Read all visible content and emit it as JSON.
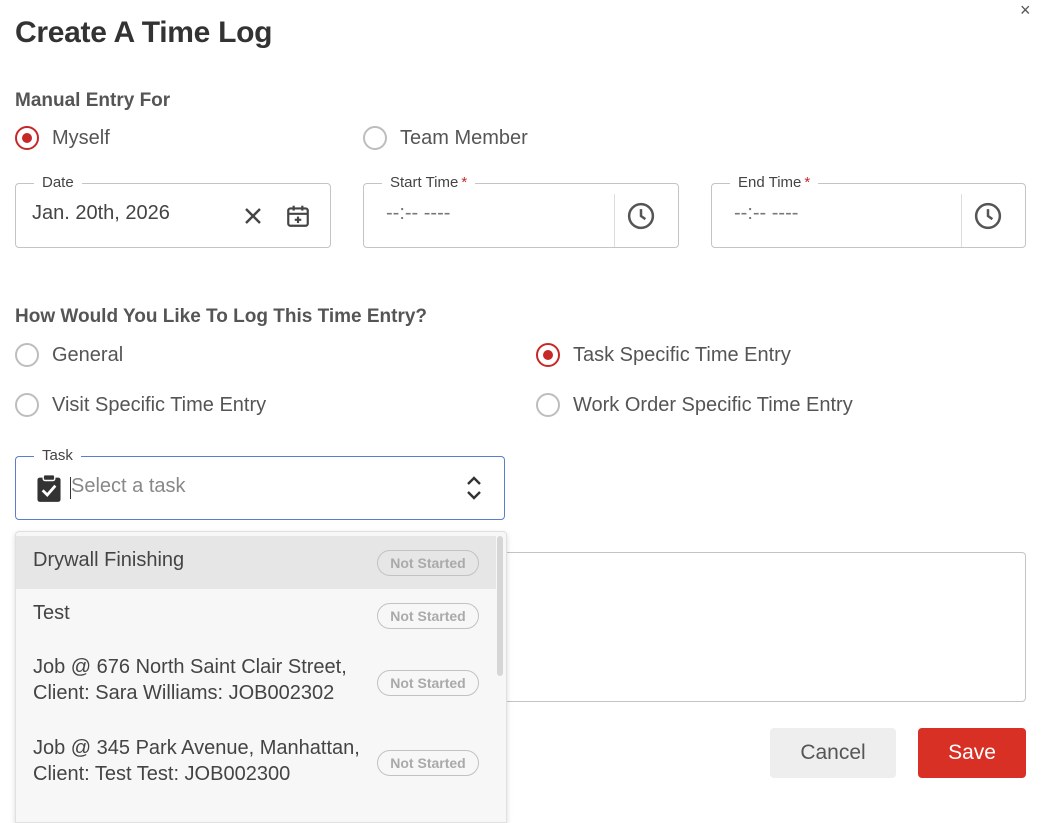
{
  "dialog": {
    "title": "Create A Time Log",
    "close_glyph": "×"
  },
  "manual_entry": {
    "label": "Manual Entry For",
    "options": [
      {
        "label": "Myself",
        "checked": true
      },
      {
        "label": "Team Member",
        "checked": false
      }
    ]
  },
  "fields": {
    "date": {
      "label": "Date",
      "value": "Jan. 20th, 2026",
      "clear_icon": "clear-icon",
      "calendar_icon": "calendar-icon"
    },
    "start_time": {
      "label": "Start Time",
      "required_mark": "*",
      "placeholder": "--:-- ----",
      "icon": "clock-icon"
    },
    "end_time": {
      "label": "End Time",
      "required_mark": "*",
      "placeholder": "--:-- ----",
      "icon": "clock-icon"
    }
  },
  "log_type": {
    "label": "How Would You Like To Log This Time Entry?",
    "options": [
      {
        "label": "General",
        "checked": false
      },
      {
        "label": "Task Specific Time Entry",
        "checked": true
      },
      {
        "label": "Visit Specific Time Entry",
        "checked": false
      },
      {
        "label": "Work Order Specific Time Entry",
        "checked": false
      }
    ]
  },
  "task": {
    "label": "Task",
    "placeholder": "Select a task",
    "icon": "clipboard-check-icon",
    "toggle_icon": "chevron-up-down-icon"
  },
  "task_options": [
    {
      "line1": "Drywall Finishing",
      "line2": "",
      "status": "Not Started",
      "highlighted": true
    },
    {
      "line1": "Test",
      "line2": "",
      "status": "Not Started",
      "highlighted": false
    },
    {
      "line1": "Job @ 676 North Saint Clair Street,",
      "line2": "Client: Sara Williams: JOB002302",
      "status": "Not Started",
      "highlighted": false
    },
    {
      "line1": "Job @ 345 Park Avenue, Manhattan,",
      "line2": "Client: Test Test: JOB002300",
      "status": "Not Started",
      "highlighted": false
    }
  ],
  "actions": {
    "cancel_label": "Cancel",
    "save_label": "Save"
  },
  "colors": {
    "accent": "#c62828",
    "save_button": "#d93025",
    "focus_border": "#5c7ccf"
  }
}
